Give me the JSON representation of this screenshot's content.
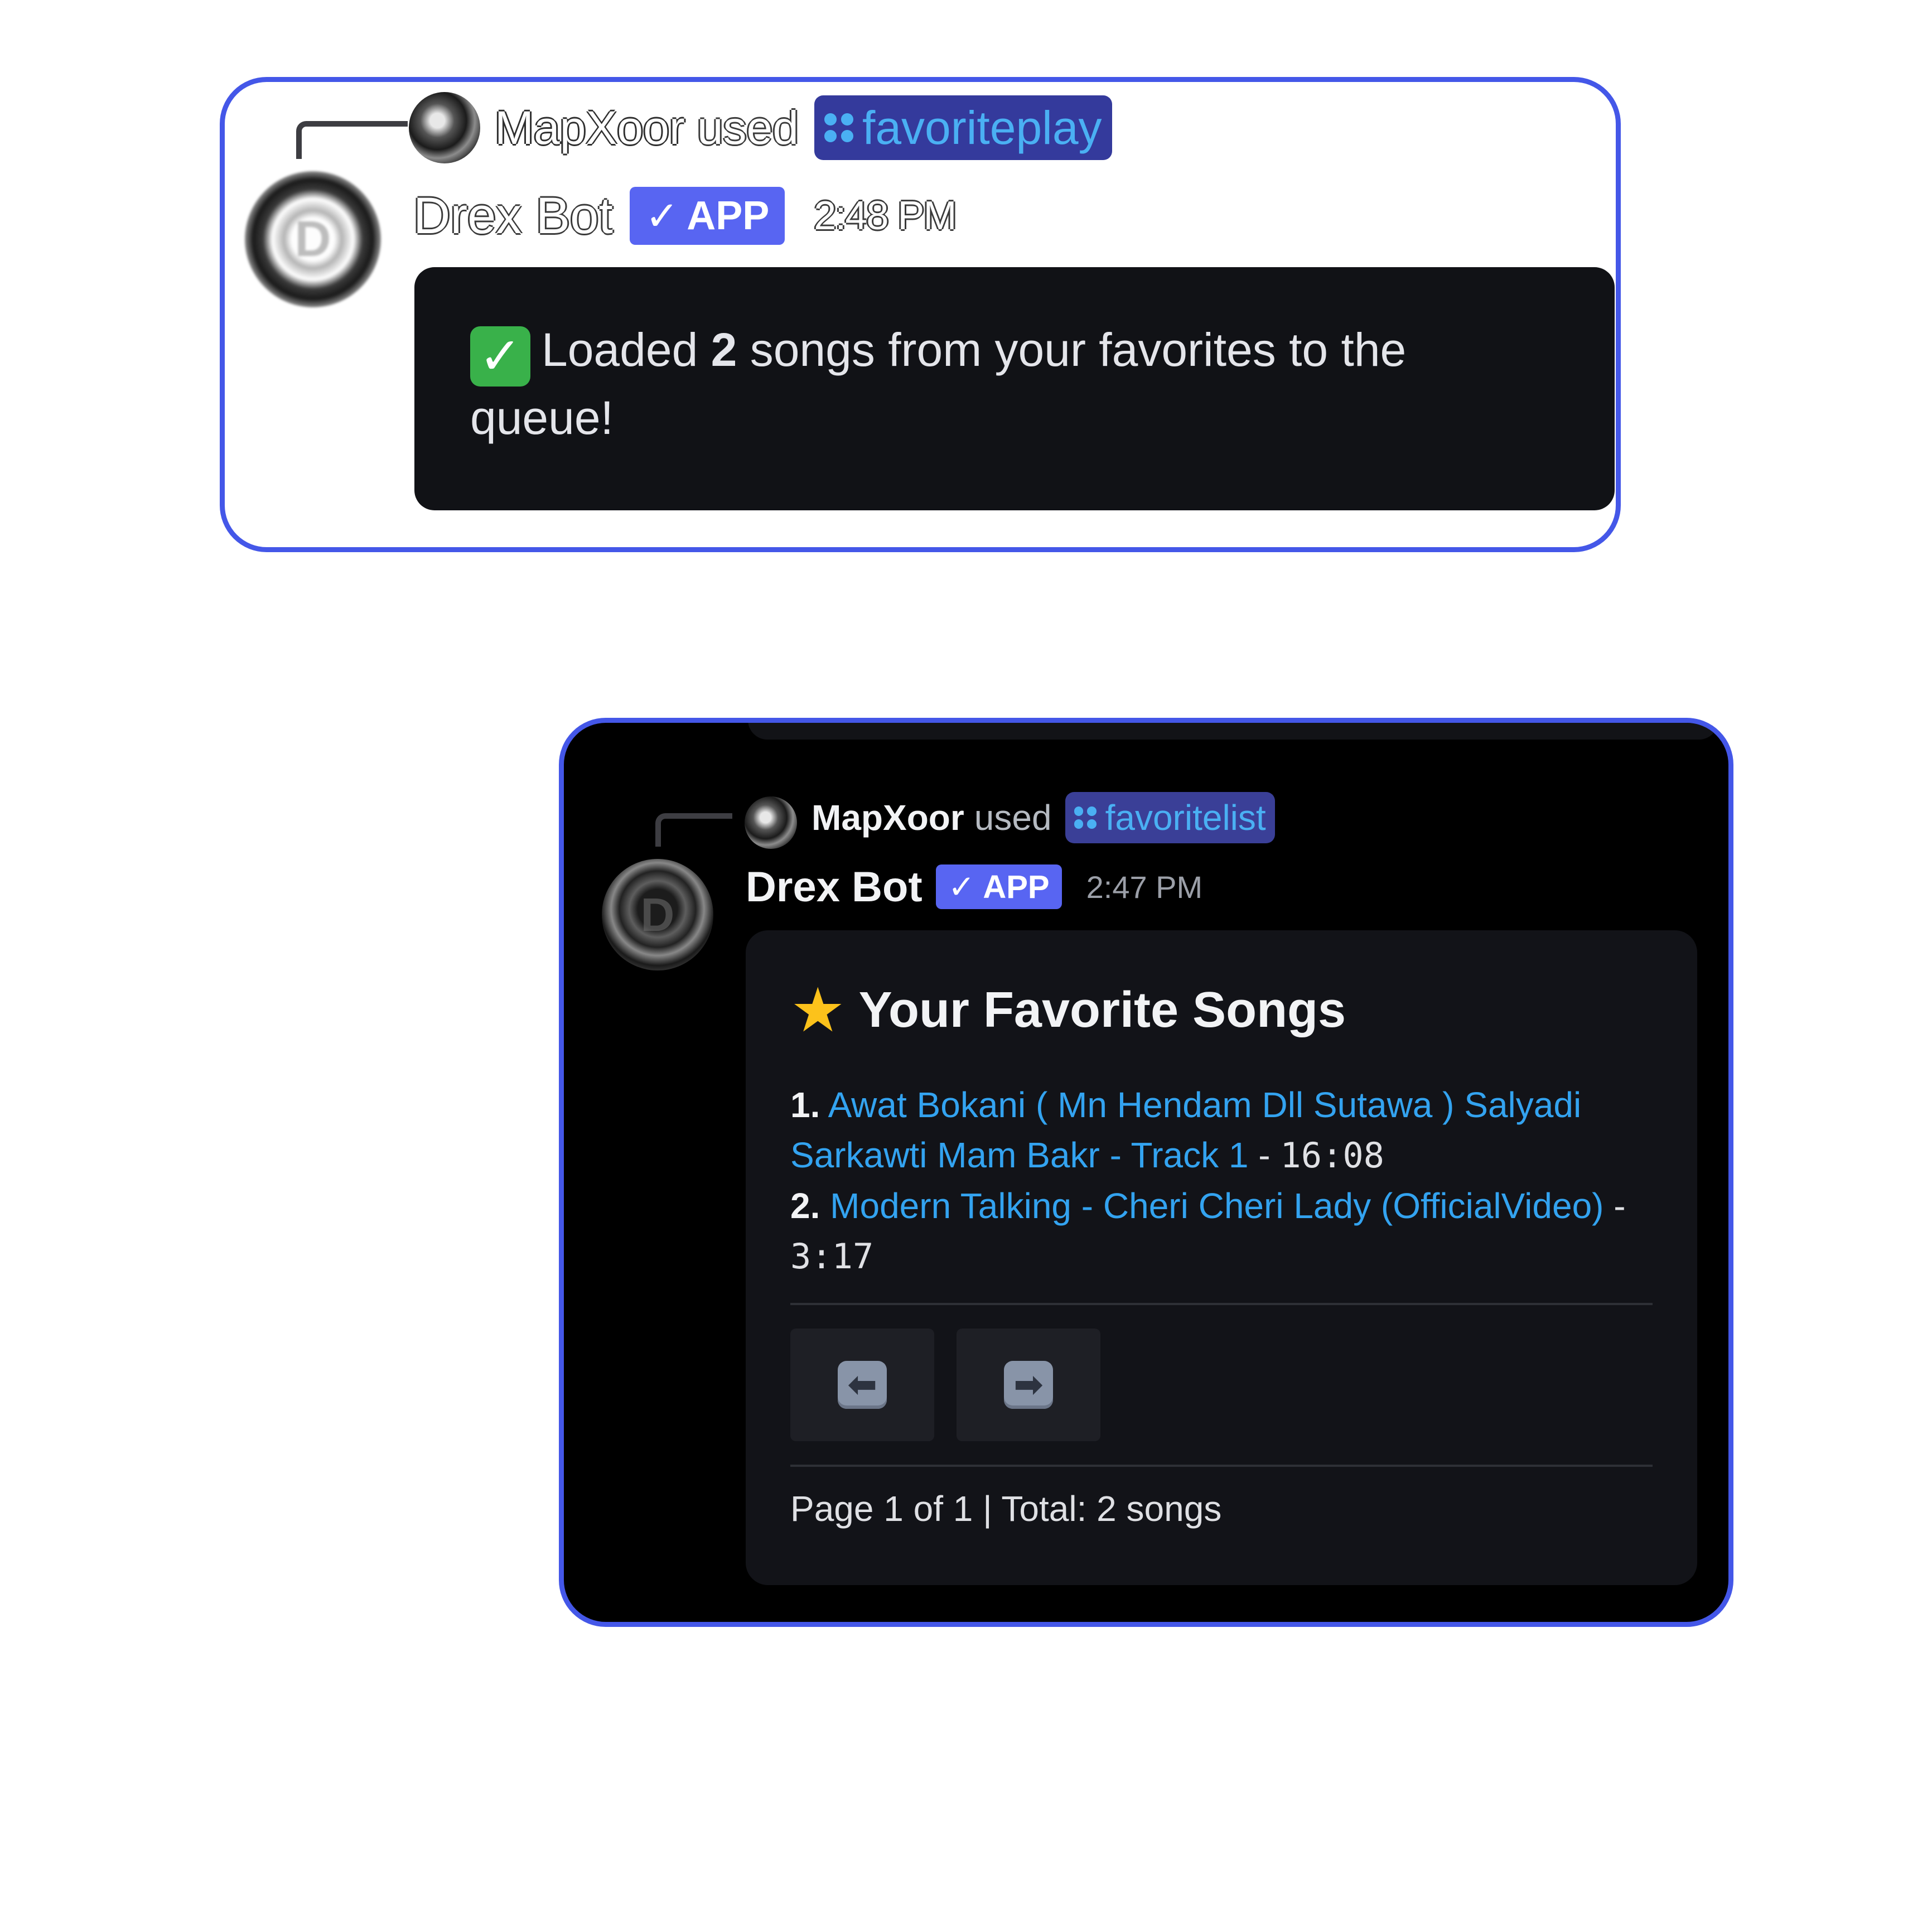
{
  "message_1": {
    "invoker_name": "MapXoor",
    "used_text": "used",
    "command": "favoriteplay",
    "bot_name": "Drex Bot",
    "app_badge": "APP",
    "timestamp": "2:48 PM",
    "embed": {
      "prefix": "Loaded",
      "count": "2",
      "suffix": "songs from your favorites to the queue!"
    }
  },
  "message_2": {
    "invoker_name": "MapXoor",
    "used_text": "used",
    "command": "favoritelist",
    "bot_name": "Drex Bot",
    "app_badge": "APP",
    "timestamp": "2:47 PM",
    "embed": {
      "title": "Your Favorite Songs",
      "songs": [
        {
          "number": "1.",
          "title": "Awat Bokani ( Mn Hendam Dll Sutawa ) Salyadi Sarkawti Mam Bakr - Track 1",
          "separator": "-",
          "duration": "16:08"
        },
        {
          "number": "2.",
          "title": "Modern Talking - Cheri Cheri Lady (OfficialVideo)",
          "separator": "-",
          "duration": "3:17"
        }
      ],
      "footer": "Page 1 of 1 | Total: 2 songs"
    }
  },
  "icons": {
    "badge_check": "✓",
    "success_emoji": "✓",
    "star_emoji": "★",
    "prev_arrow": "⬅",
    "next_arrow": "➡",
    "avatar_letter": "D"
  },
  "colors": {
    "accent_border": "#4457e8",
    "app_badge": "#5865f2",
    "link": "#33a3f0",
    "command_text": "#4ab0f3",
    "command_pill": "#3a3f97",
    "success_green": "#39b14a",
    "star_yellow": "#fcc21b"
  }
}
